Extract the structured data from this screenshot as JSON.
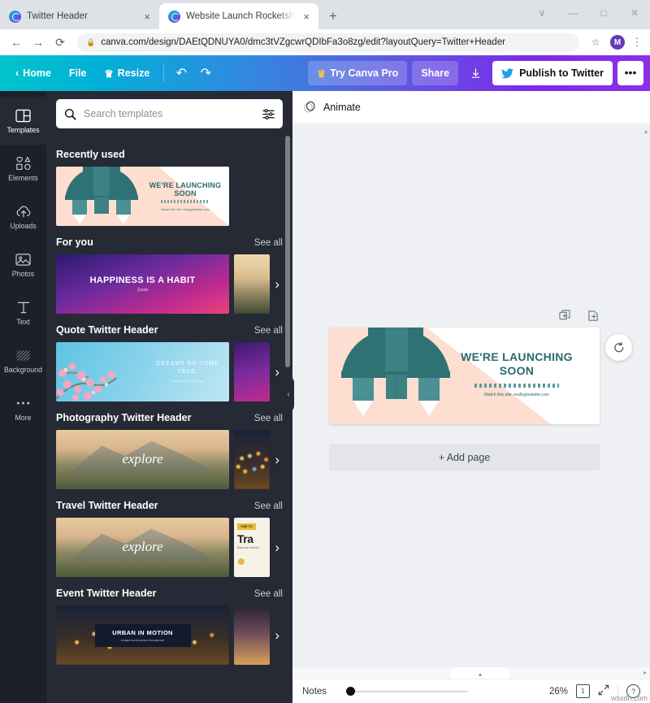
{
  "browser": {
    "tabs": [
      {
        "title": "Twitter Header",
        "favicon": "canva-icon",
        "close": "×",
        "active": false
      },
      {
        "title": "Website Launch Rocketship Twitt",
        "favicon": "canva-icon",
        "close": "×",
        "active": true
      }
    ],
    "new_tab_label": "+",
    "window_controls": {
      "minimize_list": "∨",
      "minimize": "—",
      "maximize": "□",
      "close": "✕"
    },
    "nav": {
      "back": "←",
      "forward": "→",
      "reload": "⟳"
    },
    "url": "canva.com/design/DAEtQDNUYA0/dmc3tVZgcwrQDIbFa3o8zg/edit?layoutQuery=Twitter+Header",
    "lock_icon": "🔒",
    "bookmark_star": "☆",
    "profile_initial": "M",
    "menu": "⋮"
  },
  "canva_toolbar": {
    "back_chevron": "‹",
    "home": "Home",
    "file": "File",
    "resize": "Resize",
    "resize_crown": "♛",
    "undo": "↶",
    "redo": "↷",
    "try_pro": "Try Canva Pro",
    "try_pro_crown": "♛",
    "share": "Share",
    "download": "⬇",
    "publish": "Publish to Twitter",
    "more": "•••"
  },
  "sidebar": {
    "items": [
      {
        "label": "Templates",
        "icon": "templates-icon",
        "active": true
      },
      {
        "label": "Elements",
        "icon": "elements-icon",
        "active": false
      },
      {
        "label": "Uploads",
        "icon": "uploads-icon",
        "active": false
      },
      {
        "label": "Photos",
        "icon": "photos-icon",
        "active": false
      },
      {
        "label": "Text",
        "icon": "text-icon",
        "active": false
      },
      {
        "label": "Background",
        "icon": "background-icon",
        "active": false
      },
      {
        "label": "More",
        "icon": "more-icon",
        "active": false
      }
    ]
  },
  "panel": {
    "search": {
      "placeholder": "Search templates",
      "icon": "search-icon",
      "filter_icon": "filter-icon"
    },
    "collapse_chevron": "‹",
    "see_all_label": "See all",
    "next_arrow": "›",
    "sections": [
      {
        "title": "Recently used",
        "has_see_all": false,
        "thumb": "rocketship"
      },
      {
        "title": "For you",
        "has_see_all": true,
        "thumb": "happiness",
        "peek": "dawn"
      },
      {
        "title": "Quote Twitter Header",
        "has_see_all": true,
        "thumb": "blossom",
        "peek": "purple"
      },
      {
        "title": "Photography Twitter Header",
        "has_see_all": true,
        "thumb": "explore",
        "peek": "city"
      },
      {
        "title": "Travel Twitter Header",
        "has_see_all": true,
        "thumb": "explore",
        "peek": "travel"
      },
      {
        "title": "Event Twitter Header",
        "has_see_all": true,
        "thumb": "urban",
        "peek": "fire"
      }
    ],
    "thumb_text": {
      "happiness_title": "HAPPINESS IS A HABIT",
      "happiness_sub": "Quote",
      "dreams_title": "DREAMS DO COME TRUE.",
      "dreams_sub": "We will help you achieve them",
      "explore_word": "explore",
      "urban_title": "URBAN IN MOTION",
      "urban_sub": "STREET PHOTOGRAPHY EXHIBITION",
      "travel_badge": "TIME TO",
      "travel_big": "Tra",
      "travel_sub": "Book your next trip",
      "launching_title": "WE'RE LAUNCHING SOON",
      "launching_sub": "Watch this site: reallygreatsite.com"
    }
  },
  "editor": {
    "animate_label": "Animate",
    "animate_icon": "animate-icon",
    "duplicate_icon": "duplicate-page-icon",
    "addpage_icon": "add-page-icon",
    "refresh_icon": "regenerate-icon",
    "add_page_label": "+ Add page",
    "design": {
      "headline_line1": "WE'RE LAUNCHING",
      "headline_line2": "SOON",
      "subtext": "Watch this site: reallygreatsite.com",
      "bg_color": "#fdded0",
      "accent_color": "#2b6a6b",
      "rocket_color": "#2f7273"
    }
  },
  "statusbar": {
    "notes_label": "Notes",
    "zoom_level": "26%",
    "page_number": "1",
    "expand_icon": "fullscreen-icon",
    "help_icon": "help-icon",
    "help_glyph": "?",
    "scroll_up": "▴",
    "scroll_right": "▸"
  },
  "watermark": "wsxdn.com",
  "colors": {
    "brand_start": "#00c4cc",
    "brand_end": "#7d2ae8",
    "panel_bg": "#252a35",
    "rail_bg": "#1c2029",
    "canvas_bg": "#eef0f3"
  }
}
